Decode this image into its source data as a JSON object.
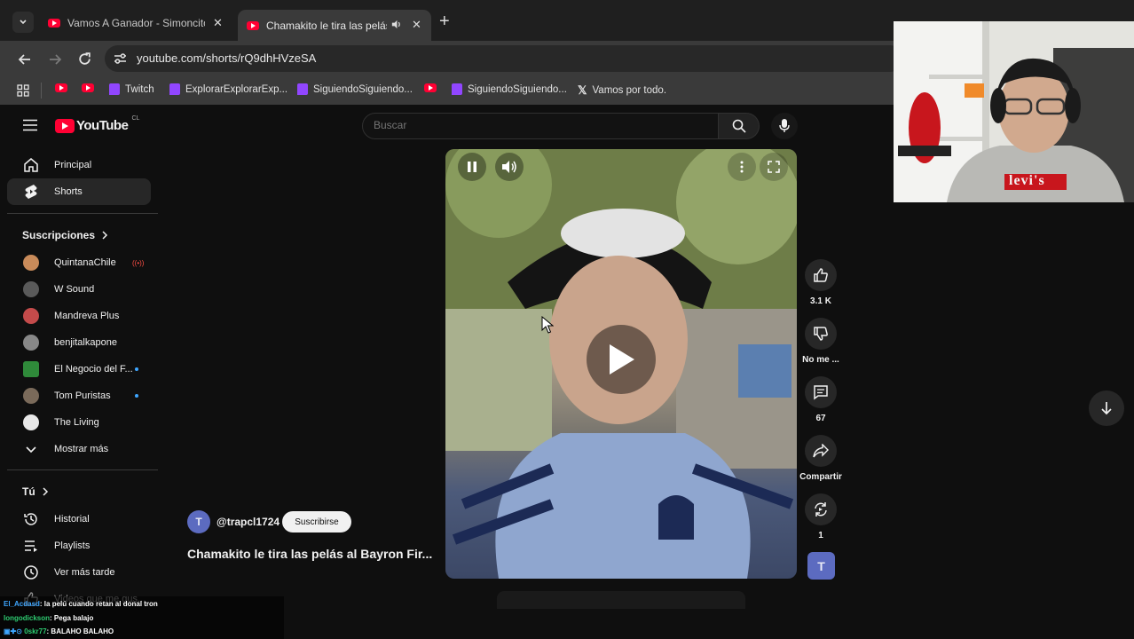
{
  "browser": {
    "tabs": [
      {
        "title": "Vamos A Ganador - Simoncito I",
        "active": false
      },
      {
        "title": "Chamakito le tira las pelás a",
        "active": true
      }
    ],
    "url": "youtube.com/shorts/rQ9dhHVzeSA",
    "bookmarks": [
      {
        "label": "",
        "type": "youtube"
      },
      {
        "label": "",
        "type": "youtube"
      },
      {
        "label": "Twitch",
        "type": "twitch"
      },
      {
        "label": "ExplorarExplorarExp...",
        "type": "twitch"
      },
      {
        "label": "SiguiendoSiguiendo...",
        "type": "twitch"
      },
      {
        "label": "",
        "type": "youtube"
      },
      {
        "label": "SiguiendoSiguiendo...",
        "type": "twitch"
      },
      {
        "label": "Vamos por todo.",
        "type": "x"
      }
    ]
  },
  "youtube": {
    "logo": "YouTube",
    "country": "CL",
    "search_placeholder": "Buscar",
    "sidebar": {
      "main": [
        {
          "label": "Principal",
          "icon": "home-icon"
        },
        {
          "label": "Shorts",
          "icon": "shorts-icon",
          "active": true
        }
      ],
      "subscriptions_title": "Suscripciones",
      "subscriptions": [
        {
          "label": "QuintanaChile",
          "live": true,
          "color": "#c98b5a"
        },
        {
          "label": "W Sound",
          "color": "#5a5a5a"
        },
        {
          "label": "Mandreva Plus",
          "color": "#c44b4b"
        },
        {
          "label": "benjitalkapone",
          "color": "#888888"
        },
        {
          "label": "El Negocio del F...",
          "dot": true,
          "color": "#2f8a3a"
        },
        {
          "label": "Tom Puristas",
          "dot": true,
          "color": "#7a6a5a"
        },
        {
          "label": "The Living",
          "color": "#e8e8e8"
        }
      ],
      "show_more": "Mostrar más",
      "you_title": "Tú",
      "you": [
        {
          "label": "Historial",
          "icon": "history-icon"
        },
        {
          "label": "Playlists",
          "icon": "playlist-icon"
        },
        {
          "label": "Ver más tarde",
          "icon": "clock-icon"
        },
        {
          "label": "Videos que me gus...",
          "icon": "like-icon"
        }
      ]
    },
    "short": {
      "channel": "@trapcl1724",
      "channel_initial": "T",
      "subscribe": "Suscribirse",
      "title": "Chamakito le tira las pelás al Bayron Fir..."
    },
    "actions": {
      "likes": "3.1 K",
      "dislike": "No me ...",
      "comments": "67",
      "share": "Compartir",
      "remix": "1",
      "channel_initial": "T"
    }
  },
  "chat": [
    {
      "user": "El_Acdasd",
      "message": ": la pelú cuando retan al donal tron",
      "color": "#3ea6ff"
    },
    {
      "user": "longodickson",
      "message": ": Pega balajo",
      "color": "#2ecc71"
    },
    {
      "user": "0skr77",
      "message": ": BALAHO BALAHO",
      "color": "#2ecc71"
    }
  ],
  "webcam": {
    "shirt_text": "levi's"
  }
}
